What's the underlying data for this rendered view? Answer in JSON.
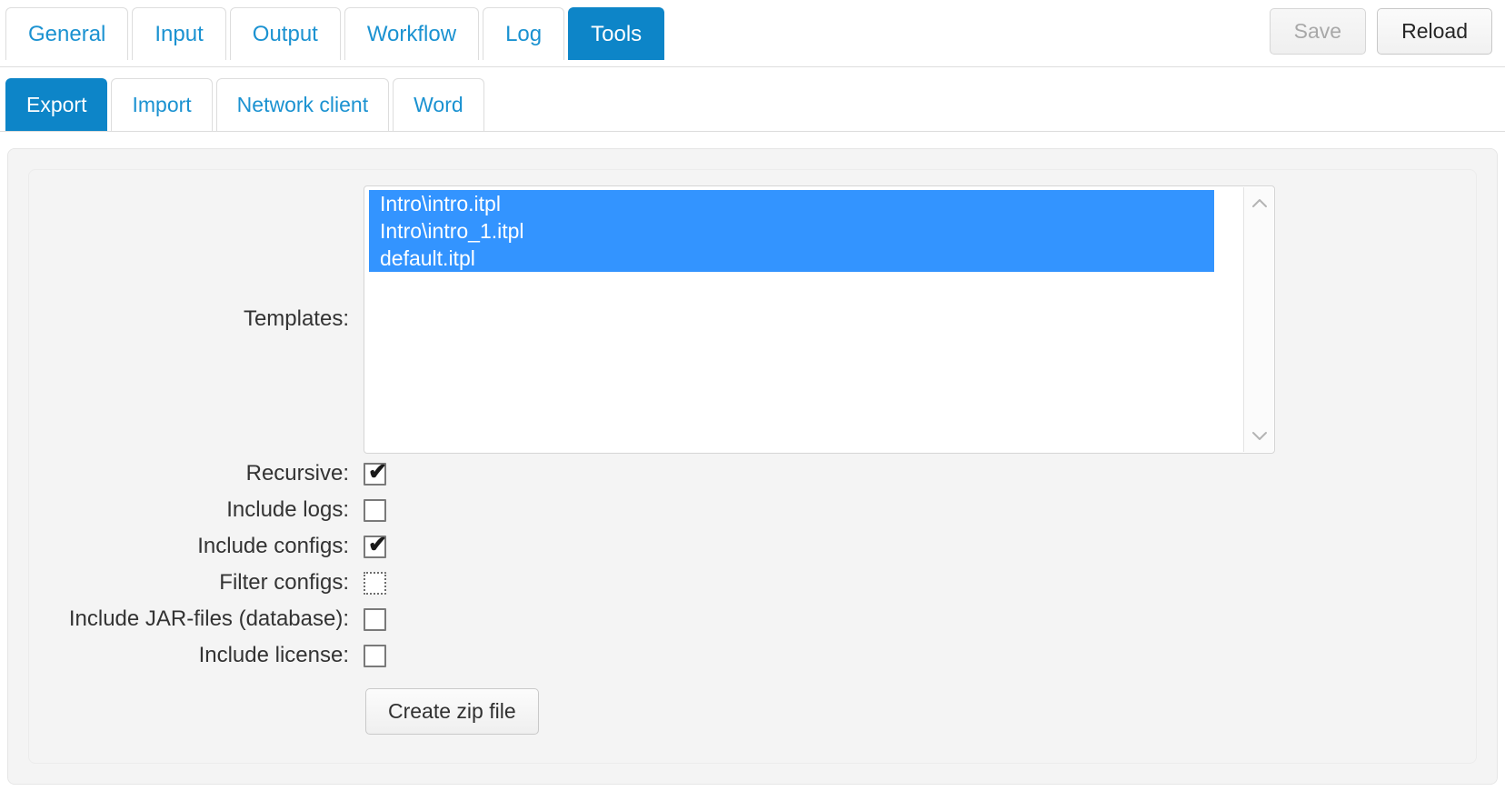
{
  "primary_tabs": [
    {
      "label": "General",
      "active": false
    },
    {
      "label": "Input",
      "active": false
    },
    {
      "label": "Output",
      "active": false
    },
    {
      "label": "Workflow",
      "active": false
    },
    {
      "label": "Log",
      "active": false
    },
    {
      "label": "Tools",
      "active": true
    }
  ],
  "top_buttons": {
    "save_label": "Save",
    "reload_label": "Reload"
  },
  "secondary_tabs": [
    {
      "label": "Export",
      "active": true
    },
    {
      "label": "Import",
      "active": false
    },
    {
      "label": "Network client",
      "active": false
    },
    {
      "label": "Word",
      "active": false
    }
  ],
  "form": {
    "templates_label": "Templates:",
    "templates": [
      {
        "name": "Intro\\intro.itpl",
        "selected": true
      },
      {
        "name": "Intro\\intro_1.itpl",
        "selected": true
      },
      {
        "name": "default.itpl",
        "selected": true
      }
    ],
    "checkboxes": [
      {
        "label": "Recursive:",
        "checked": true,
        "focused": false
      },
      {
        "label": "Include logs:",
        "checked": false,
        "focused": false
      },
      {
        "label": "Include configs:",
        "checked": true,
        "focused": false
      },
      {
        "label": "Filter configs:",
        "checked": false,
        "focused": true
      },
      {
        "label": "Include JAR-files (database):",
        "checked": false,
        "focused": false
      },
      {
        "label": "Include license:",
        "checked": false,
        "focused": false
      }
    ],
    "create_zip_label": "Create zip file"
  },
  "colors": {
    "accent": "#0d85c8",
    "link": "#1b92d1",
    "selection": "#3394ff",
    "panel_bg": "#f4f4f4"
  },
  "icons": {
    "scroll_up": "chevron-up-icon",
    "scroll_down": "chevron-down-icon",
    "checkmark": "✔"
  }
}
